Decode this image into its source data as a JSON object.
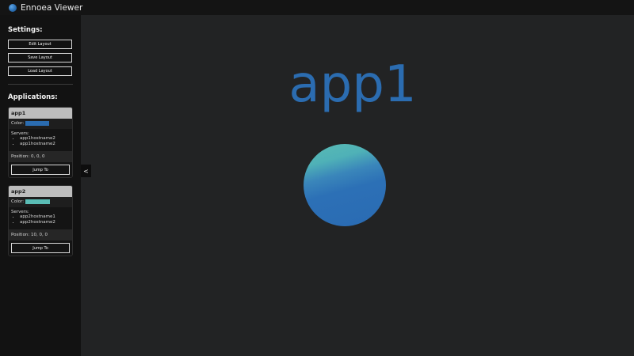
{
  "window": {
    "title": "Ennoea Viewer"
  },
  "sidebar": {
    "settings_heading": "Settings:",
    "buttons": {
      "edit_layout": "Edit Layout",
      "save_layout": "Save Layout",
      "load_layout": "Load Layout"
    },
    "applications_heading": "Applications:",
    "collapse_label": "<"
  },
  "apps": [
    {
      "name": "app1",
      "color_label": "Color:",
      "color_value": "#2B6CB0",
      "color_hex": "#2B6CB0",
      "servers_label": "Servers:",
      "servers": [
        "app1hostname2",
        "app1hostname2"
      ],
      "position_label": "Position: 0, 0, 0",
      "jump_label": "Jump To"
    },
    {
      "name": "app2",
      "color_label": "Color:",
      "color_value": "#5ABCB5",
      "color_hex": "#5ABCB5",
      "servers_label": "Servers:",
      "servers": [
        "app2hostname1",
        "app2hostname2"
      ],
      "position_label": "Position: 10, 0, 0",
      "jump_label": "Jump To"
    }
  ],
  "viewer": {
    "selected_app": "app1",
    "title_color": "#2B6CB0"
  }
}
